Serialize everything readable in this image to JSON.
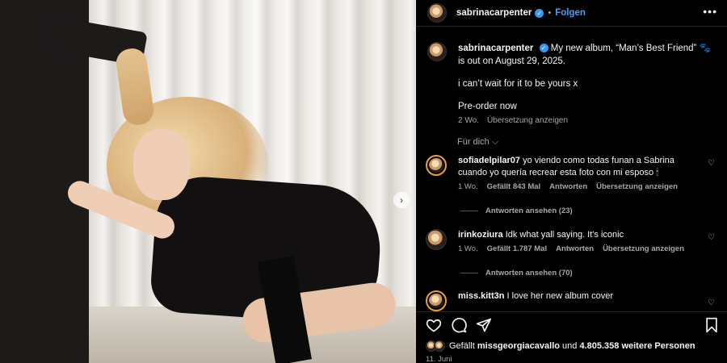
{
  "post": {
    "username": "sabrinacarpenter",
    "follow_label": "Folgen",
    "dot": "•",
    "more_label": "•••",
    "next_label": "›"
  },
  "caption": {
    "username": "sabrinacarpenter",
    "line1": "My new album, “Man’s Best Friend” 🐾",
    "line2": "is out on August 29, 2025.",
    "line3": "i can’t wait for it to be yours x",
    "line4": "Pre-order now",
    "time": "2 Wo.",
    "translate": "Übersetzung anzeigen"
  },
  "for_you": "Für dich ⌵",
  "comments": [
    {
      "username": "sofiadelpilar07",
      "text": "yo viendo como todas funan a Sabrina cuando yo quería recrear esta foto con mi esposo 🕯",
      "time": "1 Wo.",
      "likes": "Gefällt 843 Mal",
      "reply": "Antworten",
      "translate": "Übersetzung anzeigen",
      "view_replies": "Antworten ansehen (23)"
    },
    {
      "username": "irinkoziura",
      "text": "Idk what yall saying. It's iconic",
      "time": "1 Wo.",
      "likes": "Gefällt 1.787 Mal",
      "reply": "Antworten",
      "translate": "Übersetzung anzeigen",
      "view_replies": "Antworten ansehen (70)"
    },
    {
      "username": "miss.kitt3n",
      "text": "I love her new album cover"
    }
  ],
  "likes_line": {
    "prefix": "Gefällt",
    "user": "missgeorgiacavallo",
    "middle": "und",
    "count": "4.805.358 weitere Personen"
  },
  "date": "11. Juni",
  "colors": {
    "accent": "#4a9df8",
    "verified": "#3897f0",
    "background": "#000000",
    "muted": "#a8a8a8"
  }
}
